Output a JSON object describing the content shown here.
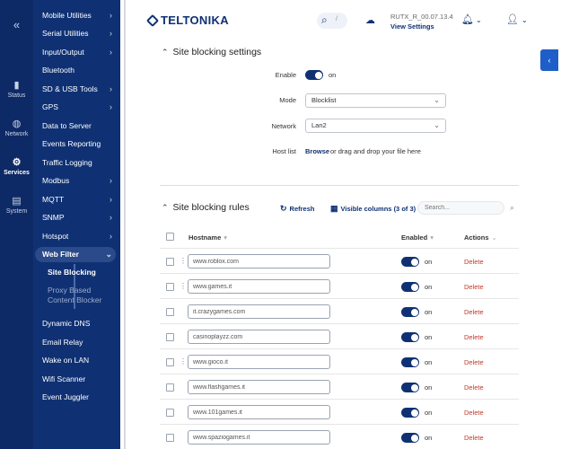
{
  "rail": {
    "collapse_icon": "double-chevron-left-icon",
    "items": [
      {
        "label": "Status",
        "icon": "bar-chart-icon"
      },
      {
        "label": "Network",
        "icon": "globe-icon"
      },
      {
        "label": "Services",
        "icon": "gear-icon"
      },
      {
        "label": "System",
        "icon": "document-icon"
      }
    ]
  },
  "submenu": {
    "items": [
      {
        "label": "Mobile Utilities",
        "chevron": "›"
      },
      {
        "label": "Serial Utilities",
        "chevron": "›"
      },
      {
        "label": "Input/Output",
        "chevron": "›"
      },
      {
        "label": "Bluetooth",
        "chevron": ""
      },
      {
        "label": "SD & USB Tools",
        "chevron": "›"
      },
      {
        "label": "GPS",
        "chevron": "›"
      },
      {
        "label": "Data to Server",
        "chevron": ""
      },
      {
        "label": "Events Reporting",
        "chevron": ""
      },
      {
        "label": "Traffic Logging",
        "chevron": ""
      },
      {
        "label": "Modbus",
        "chevron": "›"
      },
      {
        "label": "MQTT",
        "chevron": "›"
      },
      {
        "label": "SNMP",
        "chevron": "›"
      },
      {
        "label": "Hotspot",
        "chevron": "›"
      },
      {
        "label": "Web Filter",
        "chevron": "⌄"
      },
      {
        "label": "Dynamic DNS",
        "chevron": ""
      },
      {
        "label": "Email Relay",
        "chevron": ""
      },
      {
        "label": "Wake on LAN",
        "chevron": ""
      },
      {
        "label": "Wifi Scanner",
        "chevron": ""
      },
      {
        "label": "Event Juggler",
        "chevron": ""
      }
    ],
    "web_filter_sub": {
      "site_blocking": "Site Blocking",
      "proxy_line1": "Proxy Based",
      "proxy_line2": "Content Blocker"
    }
  },
  "header": {
    "logo": "TELTONIKA",
    "search_shortcut": "/",
    "firmware": "RUTX_R_00.07.13.4",
    "view_settings": "View Settings"
  },
  "settings": {
    "title": "Site blocking settings",
    "enable_label": "Enable",
    "enable_state": "on",
    "mode_label": "Mode",
    "mode_value": "Blocklist",
    "network_label": "Network",
    "network_value": "Lan2",
    "hostlist_label": "Host list",
    "browse_label": "Browse",
    "drop_text": "or drag and drop your file here"
  },
  "rules": {
    "title": "Site blocking rules",
    "refresh_label": "Refresh",
    "visible_columns_label": "Visible columns (3 of 3)",
    "search_placeholder": "Search...",
    "columns": {
      "hostname": "Hostname",
      "enabled": "Enabled",
      "actions": "Actions"
    },
    "rows": [
      {
        "hostname": "www.roblox.com",
        "enabled": "on",
        "action": "Delete"
      },
      {
        "hostname": "www.games.it",
        "enabled": "on",
        "action": "Delete"
      },
      {
        "hostname": "it.crazygames.com",
        "enabled": "on",
        "action": "Delete"
      },
      {
        "hostname": "casinoplayzz.com",
        "enabled": "on",
        "action": "Delete"
      },
      {
        "hostname": "www.gioco.it",
        "enabled": "on",
        "action": "Delete"
      },
      {
        "hostname": "www.flashgames.it",
        "enabled": "on",
        "action": "Delete"
      },
      {
        "hostname": "www.101games.it",
        "enabled": "on",
        "action": "Delete"
      },
      {
        "hostname": "www.spaziogames.it",
        "enabled": "on",
        "action": "Delete"
      }
    ]
  },
  "colors": {
    "navy": "#0f3174",
    "rail": "#0e2a66",
    "delete": "#c0392b",
    "side_tab": "#1e5ec8"
  }
}
